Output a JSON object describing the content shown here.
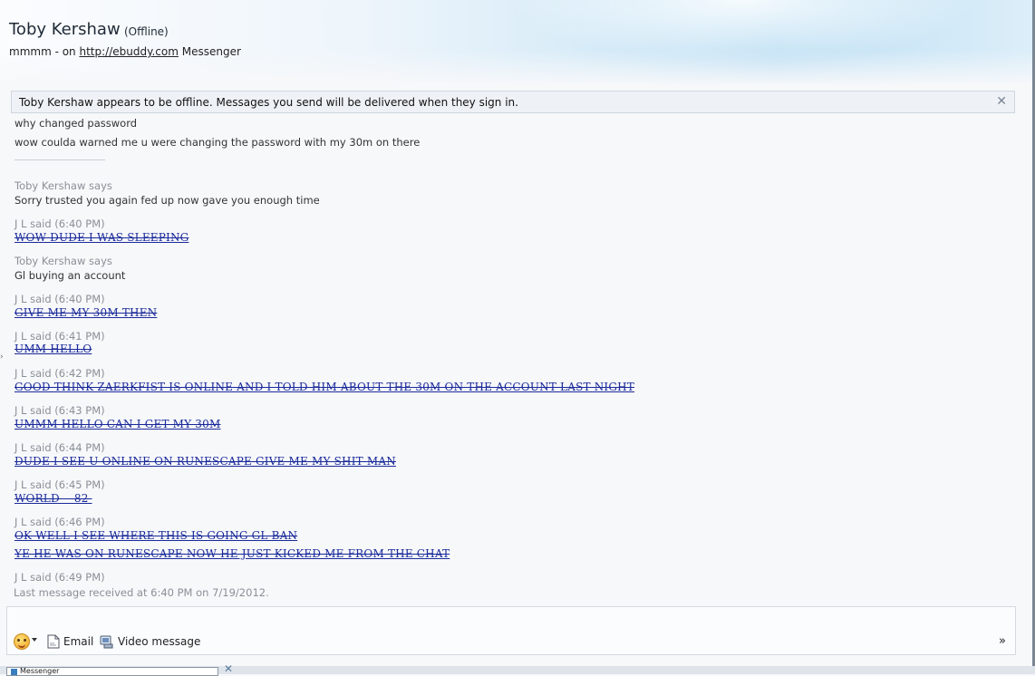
{
  "header": {
    "contact_name": "Toby Kershaw",
    "status": "(Offline)",
    "message_prefix": "mmmm - on ",
    "message_link": "http://ebuddy.com",
    "message_suffix": " Messenger"
  },
  "notice": {
    "text": "Toby Kershaw appears to be offline. Messages you send will be delivered when they sign in.",
    "close_icon": "close-icon"
  },
  "conversation": {
    "l1": "why changed password",
    "l2": "wow coulda warned me u were changing the password with my 30m on there",
    "l3": "Toby Kershaw says",
    "l4": "Sorry trusted you again fed up now gave you enough time",
    "l5": "J L said (6:40 PM)",
    "l6": "WOW DUDE I WAS SLEEPING ",
    "l7": "Toby Kershaw says",
    "l8": "Gl buying an account",
    "l9": "J L said (6:40 PM)",
    "l10": "GIVE ME MY 30M THEN ",
    "l11": "J L said (6:41 PM)",
    "l12": "UMM HELLO ",
    "l13": "J L said (6:42 PM)",
    "l14": "GOOD THINK ZAERKFIST IS ONLINE AND I TOLD HIM ABOUT THE 30M ON THE ACCOUNT LAST NIGHT ",
    "l15": "J L said (6:43 PM)",
    "l16": "UMMM HELLO CAN I GET MY 30M ",
    "l17": "J L said (6:44 PM)",
    "l18": "DUDE I SEE U ONLINE ON RUNESCAPE GIVE ME MY SHIT MAN ",
    "l19": "J L said (6:45 PM)",
    "l20": "WORLD    82 ",
    "l21": "J L said (6:46 PM)",
    "l22": "OK WELL I SEE WHERE THIS IS GOING GL BAN ",
    "l23": "YE HE WAS ON RUNESCAPE NOW HE JUST KICKED ME FROM THE CHAT ",
    "l24": "J L said (6:49 PM)"
  },
  "footer_status": "Last message received at 6:40 PM on 7/19/2012.",
  "toolbar": {
    "emoticon_icon": "emoticon-icon",
    "email_label": "Email",
    "video_label": "Video message",
    "more_label": "»"
  },
  "taskbar": {
    "item_label": "Messenger"
  },
  "colors": {
    "strike_text": "#1a2a9a",
    "meta_text": "#8a8f96",
    "notice_bg": "#eef2f6"
  }
}
